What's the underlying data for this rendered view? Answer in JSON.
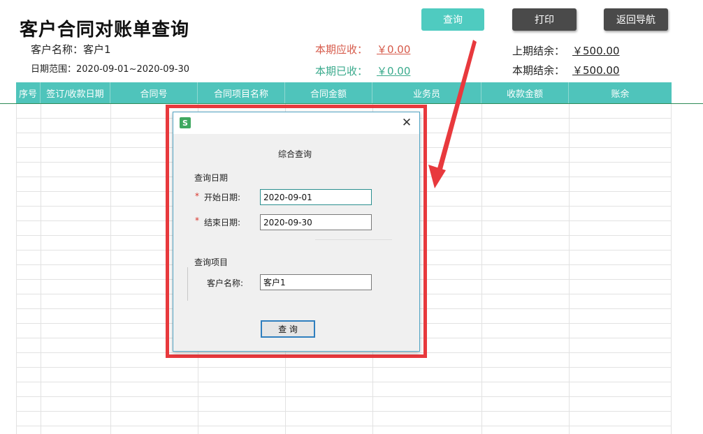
{
  "header": {
    "title": "客户合同对账单查询",
    "customer_label": "客户名称：",
    "customer_value": "客户1",
    "date_label": "日期范围：",
    "date_value": "2020-09-01~2020-09-30"
  },
  "toolbar": {
    "query_label": "查询",
    "print_label": "打印",
    "nav_label": "返回导航"
  },
  "summary": {
    "receivable_label": "本期应收：",
    "receivable_value": "￥0.00",
    "received_label": "本期已收：",
    "received_value": "￥0.00",
    "prev_balance_label": "上期结余：",
    "prev_balance_value": "￥500.00",
    "curr_balance_label": "本期结余：",
    "curr_balance_value": "￥500.00"
  },
  "table": {
    "columns": [
      "序号",
      "签订/收款日期",
      "合同号",
      "合同项目名称",
      "合同金额",
      "业务员",
      "收款金额",
      "账余"
    ]
  },
  "dialog": {
    "app_icon_letter": "S",
    "close_glyph": "✕",
    "heading": "综合查询",
    "date_group_label": "查询日期",
    "required_mark": "*",
    "start_label": "开始日期:",
    "start_value": "2020-09-01",
    "end_label": "结束日期:",
    "end_value": "2020-09-30",
    "item_group_label": "查询项目",
    "customer_label": "客户名称:",
    "customer_value": "客户1",
    "query_button": "查 询"
  },
  "colors": {
    "accent_teal": "#4fc4bb",
    "button_dark": "#4a4a4a",
    "annotation_red": "#e8393d",
    "receivable_red": "#d65a4a",
    "received_green": "#3aaa8c"
  },
  "icons": {
    "app": "app-logo-icon",
    "close": "close-icon",
    "annotation": "arrow-annotation-icon"
  }
}
